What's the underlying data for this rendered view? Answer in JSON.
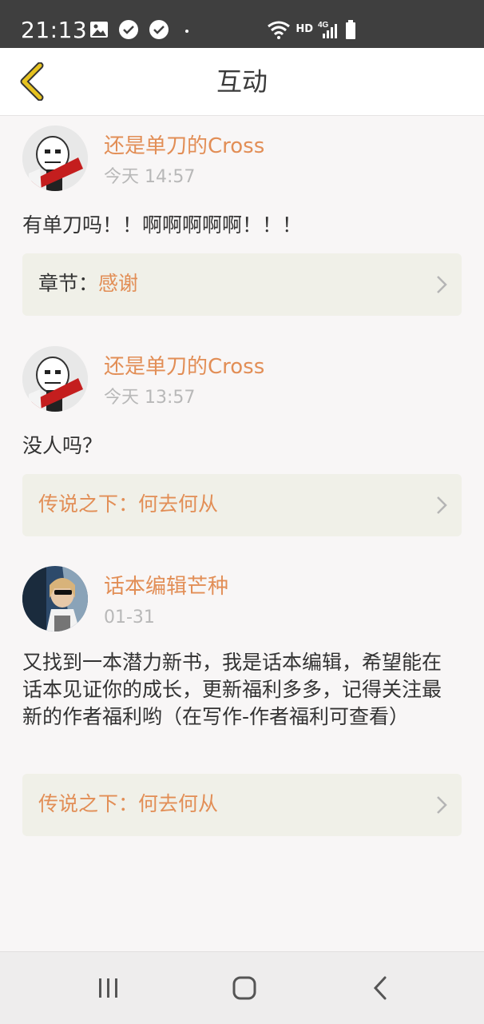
{
  "status_bar": {
    "time": "21:13",
    "network_label": "HD",
    "network_type": "4G",
    "icons": [
      "image-icon",
      "check-badge-icon",
      "check-badge-icon",
      "dot-icon",
      "wifi-icon",
      "signal-icon",
      "battery-icon"
    ]
  },
  "header": {
    "title": "互动",
    "back_icon": "chevron-left-icon",
    "accent_color": "#e6c21f"
  },
  "feed": [
    {
      "user": "还是单刀的Cross",
      "time": "今天 14:57",
      "text": "有单刀吗！！啊啊啊啊啊！！！",
      "ref_label": "章节：",
      "ref_title": "感谢"
    },
    {
      "user": "还是单刀的Cross",
      "time": "今天 13:57",
      "text": "没人吗？",
      "ref_label": "",
      "ref_title": "传说之下：何去何从"
    },
    {
      "user": "话本编辑芒种",
      "time": "01-31",
      "text": "又找到一本潜力新书，我是话本编辑，希望能在话本见证你的成长，更新福利多多，记得关注最新的作者福利哟（在写作-作者福利可查看）",
      "ref_label": "",
      "ref_title": "传说之下：何去何从"
    }
  ],
  "colors": {
    "name": "#e28e56",
    "time": "#b8b8b8",
    "card_bg": "#f0f0e8",
    "status_bar": "#3f3f3f"
  },
  "nav": {
    "icons": [
      "recent-apps-icon",
      "home-icon",
      "back-icon"
    ]
  }
}
